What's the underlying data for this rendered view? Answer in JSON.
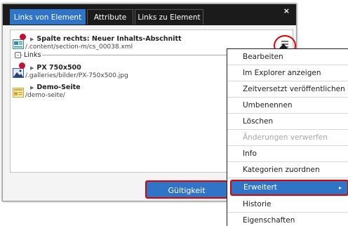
{
  "dialog": {
    "tabs": [
      "Links von Element",
      "Attribute",
      "Links zu Element"
    ],
    "close_symbol": "×",
    "main_entry": {
      "title": "Spalte rechts: Neuer Inhalts-Abschnitt",
      "path": "/.content/section-m/cs_00038.xml",
      "icon": "section-icon"
    },
    "group_label": "Links",
    "group_toggle": "−",
    "links": [
      {
        "title": "PX 750x500",
        "path": "/.galleries/bilder/PX-750x500.jpg",
        "icon": "image-icon"
      },
      {
        "title": "Demo-Seite",
        "path": "/demo-seite/",
        "icon": "page-icon"
      }
    ],
    "validity_button": "Gültigkeit"
  },
  "context_menu": {
    "items": [
      {
        "label": "Bearbeiten",
        "state": "normal"
      },
      {
        "label": "Im Explorer anzeigen",
        "state": "normal"
      },
      {
        "label": "Zeitversetzt veröffentlichen",
        "state": "normal"
      },
      {
        "label": "Umbenennen",
        "state": "normal"
      },
      {
        "label": "Löschen",
        "state": "normal"
      },
      {
        "label": "Änderungen verwerfen",
        "state": "disabled"
      },
      {
        "label": "Info",
        "state": "normal"
      },
      {
        "label": "Kategorien zuordnen",
        "state": "normal"
      },
      {
        "label": "Erweitert",
        "state": "highlight",
        "submenu": "▸"
      },
      {
        "label": "Historie",
        "state": "normal"
      },
      {
        "label": "Eigenschaften",
        "state": "normal"
      }
    ]
  },
  "colors": {
    "accent_blue": "#2f74c7",
    "highlight_red": "#e00000",
    "titlebar": "#1b1b1b"
  }
}
